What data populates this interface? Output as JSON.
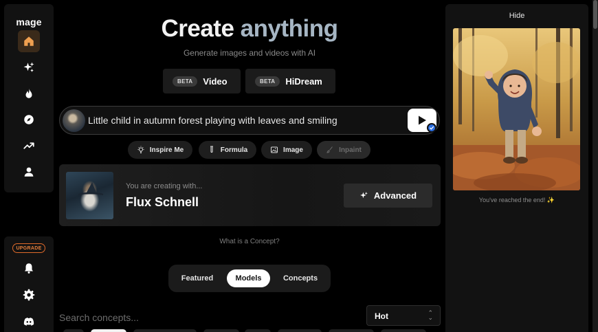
{
  "app": {
    "logo": "mage"
  },
  "sidebar": {
    "items": [
      {
        "icon": "home-icon",
        "active": true
      },
      {
        "icon": "sparkles-icon",
        "active": false
      },
      {
        "icon": "flame-icon",
        "active": false
      },
      {
        "icon": "compass-icon",
        "active": false
      },
      {
        "icon": "trending-icon",
        "active": false
      },
      {
        "icon": "user-icon",
        "active": false
      }
    ],
    "upgrade_label": "UPGRADE",
    "bottom_items": [
      {
        "icon": "bell-icon"
      },
      {
        "icon": "gear-icon"
      },
      {
        "icon": "discord-icon"
      }
    ]
  },
  "hero": {
    "title_part1": "Create",
    "title_part2": "anything",
    "subtitle": "Generate images and videos with AI"
  },
  "modes": [
    {
      "badge": "BETA",
      "label": "Video"
    },
    {
      "badge": "BETA",
      "label": "HiDream"
    }
  ],
  "prompt": {
    "value": "Little child in autumn forest playing with leaves and smiling"
  },
  "tools": [
    {
      "label": "Inspire Me",
      "icon": "lightbulb-icon",
      "disabled": false
    },
    {
      "label": "Formula",
      "icon": "test-tube-icon",
      "disabled": false
    },
    {
      "label": "Image",
      "icon": "image-icon",
      "disabled": false
    },
    {
      "label": "Inpaint",
      "icon": "brush-icon",
      "disabled": true
    }
  ],
  "model_card": {
    "caption": "You are creating with...",
    "model_name": "Flux Schnell",
    "advanced_label": "Advanced"
  },
  "concept_link": "What is a Concept?",
  "tabs": [
    {
      "label": "Featured",
      "active": false
    },
    {
      "label": "Models",
      "active": true
    },
    {
      "label": "Concepts",
      "active": false
    }
  ],
  "search": {
    "placeholder": "Search concepts..."
  },
  "sort": {
    "selected": "Hot"
  },
  "right_panel": {
    "hide_label": "Hide",
    "end_message": "You've reached the end! ✨"
  },
  "colors": {
    "accent_orange": "#e8803c",
    "hero_secondary": "#a6b6c4",
    "check_blue": "#2a6de0"
  }
}
